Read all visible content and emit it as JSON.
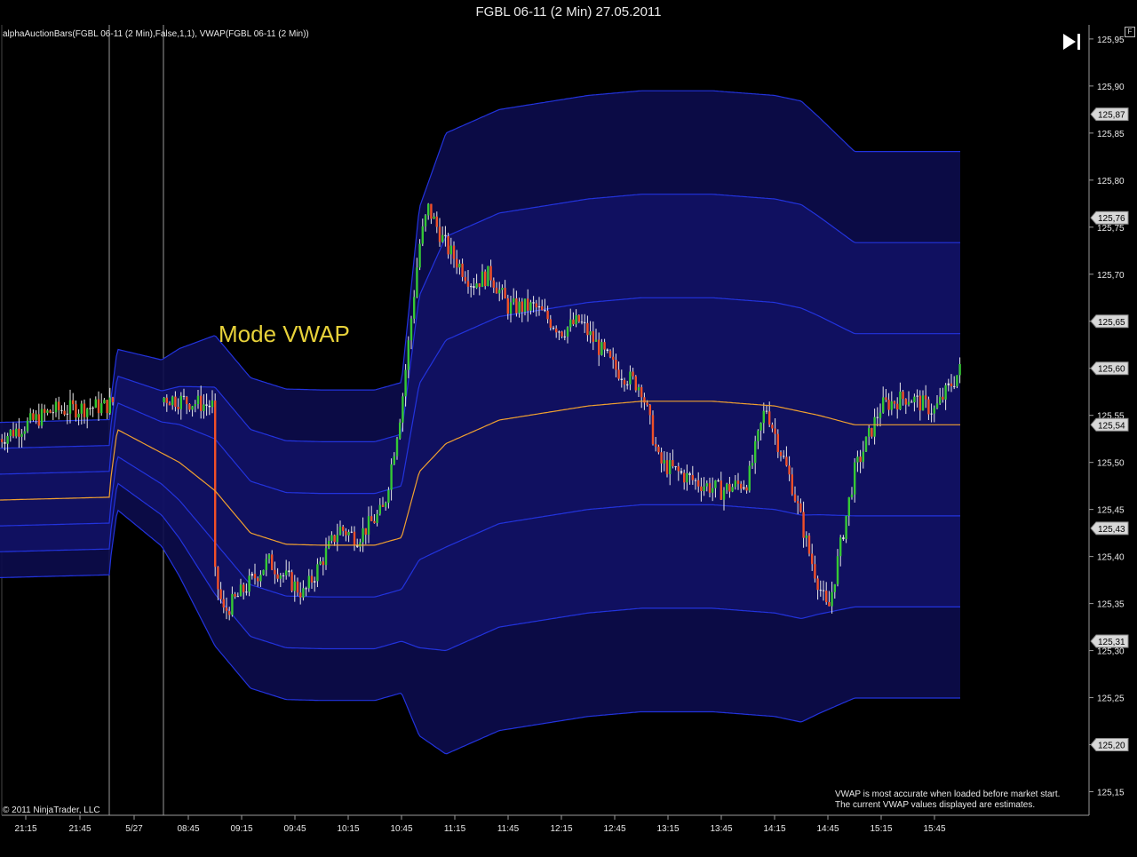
{
  "window": {
    "title": "FGBL 06-11 (2 Min)  27.05.2011",
    "float_button_label": "F"
  },
  "indicator_label": "alphaAuctionBars(FGBL 06-11 (2 Min),False,1,1), VWAP(FGBL 06-11 (2 Min))",
  "annotation": "Mode VWAP",
  "copyright": "© 2011 NinjaTrader, LLC",
  "note": "VWAP is most accurate when loaded before market start.\nThe current VWAP values displayed are estimates.",
  "colors": {
    "background": "#000000",
    "grid": "#9a9a9a",
    "band_line": "#2233dd",
    "band_fill": "#0c0c4c",
    "vwap_line": "#f0a030",
    "candle_up": "#35c835",
    "candle_down": "#f05028",
    "candle_neutral": "#e8e8e8",
    "annotation": "#e8d23a"
  },
  "chart_data": {
    "type": "candlestick",
    "title": "FGBL 06-11 (2 Min)  27.05.2011",
    "x_tick_labels": [
      "21:15",
      "21:45",
      "5/27",
      "08:45",
      "09:15",
      "09:45",
      "10:15",
      "10:45",
      "11:15",
      "11:45",
      "12:15",
      "12:45",
      "13:15",
      "13:45",
      "14:15",
      "14:45",
      "15:15",
      "15:45"
    ],
    "y_tick_labels": [
      "125,95",
      "125,90",
      "125,85",
      "125,80",
      "125,75",
      "125,70",
      "125,65",
      "125,60",
      "125,55",
      "125,50",
      "125,45",
      "125,40",
      "125,35",
      "125,30",
      "125,25",
      "125,20",
      "125,15"
    ],
    "ylim": [
      125.125,
      125.965
    ],
    "session_separators": [
      "5/27 00:00",
      "5/27 08:00"
    ],
    "price_markers": [
      {
        "label": "125,87",
        "value": 125.87
      },
      {
        "label": "125,76",
        "value": 125.76
      },
      {
        "label": "125,65",
        "value": 125.65
      },
      {
        "label": "125,60",
        "value": 125.6
      },
      {
        "label": "125,54",
        "value": 125.54
      },
      {
        "label": "125,43",
        "value": 125.43
      },
      {
        "label": "125,31",
        "value": 125.31
      },
      {
        "label": "125,20",
        "value": 125.2
      }
    ],
    "vwap": [
      [
        "21:00",
        125.46
      ],
      [
        "00:00",
        125.463
      ],
      [
        "08:00",
        125.463
      ],
      [
        "08:05",
        125.535
      ],
      [
        "08:40",
        125.5
      ],
      [
        "09:00",
        125.47
      ],
      [
        "09:20",
        125.425
      ],
      [
        "09:40",
        125.413
      ],
      [
        "10:00",
        125.412
      ],
      [
        "10:30",
        125.412
      ],
      [
        "10:45",
        125.42
      ],
      [
        "10:55",
        125.49
      ],
      [
        "11:10",
        125.52
      ],
      [
        "11:40",
        125.545
      ],
      [
        "12:30",
        125.56
      ],
      [
        "13:00",
        125.565
      ],
      [
        "13:40",
        125.565
      ],
      [
        "14:15",
        125.56
      ],
      [
        "14:40",
        125.55
      ],
      [
        "15:00",
        125.54
      ],
      [
        "15:40",
        125.54
      ],
      [
        "16:00",
        125.54
      ]
    ],
    "bands": {
      "offsets": [
        -0.33,
        -0.22,
        -0.11,
        0.11,
        0.22,
        0.33
      ],
      "session_widths": [
        [
          "21:00",
          0.25
        ],
        [
          "00:00",
          0.25
        ],
        [
          "08:00",
          0.25
        ],
        [
          "08:30",
          0.3
        ],
        [
          "09:00",
          0.5
        ],
        [
          "10:45",
          0.5
        ],
        [
          "10:55",
          0.85
        ],
        [
          "11:10",
          1.0
        ],
        [
          "14:30",
          1.0
        ],
        [
          "15:00",
          0.88
        ],
        [
          "16:00",
          0.88
        ]
      ]
    },
    "ohlc_path": [
      [
        "21:00",
        125.525
      ],
      [
        "21:30",
        125.555
      ],
      [
        "22:00",
        125.56
      ],
      [
        "22:15",
        125.575
      ],
      [
        "23:00",
        125.56
      ],
      [
        "00:00",
        125.6
      ],
      [
        "00:30",
        125.47
      ],
      [
        "01:30",
        125.48
      ],
      [
        "07:59",
        125.5
      ],
      [
        "08:00",
        125.555
      ],
      [
        "08:15",
        125.52
      ],
      [
        "08:35",
        125.48
      ],
      [
        "08:55",
        125.42
      ],
      [
        "09:05",
        125.34
      ],
      [
        "09:30",
        125.395
      ],
      [
        "09:50",
        125.36
      ],
      [
        "10:10",
        125.43
      ],
      [
        "10:20",
        125.42
      ],
      [
        "10:35",
        125.45
      ],
      [
        "10:45",
        125.56
      ],
      [
        "10:55",
        125.73
      ],
      [
        "11:00",
        125.77
      ],
      [
        "11:10",
        125.73
      ],
      [
        "11:25",
        125.69
      ],
      [
        "11:35",
        125.7
      ],
      [
        "11:45",
        125.665
      ],
      [
        "12:00",
        125.665
      ],
      [
        "12:15",
        125.64
      ],
      [
        "12:25",
        125.65
      ],
      [
        "12:45",
        125.6
      ],
      [
        "13:00",
        125.58
      ],
      [
        "13:10",
        125.5
      ],
      [
        "13:30",
        125.48
      ],
      [
        "13:45",
        125.47
      ],
      [
        "14:00",
        125.48
      ],
      [
        "14:10",
        125.56
      ],
      [
        "14:25",
        125.475
      ],
      [
        "14:35",
        125.4
      ],
      [
        "14:45",
        125.34
      ],
      [
        "15:00",
        125.49
      ],
      [
        "15:15",
        125.56
      ],
      [
        "15:30",
        125.57
      ],
      [
        "15:45",
        125.555
      ],
      [
        "16:00",
        125.6
      ]
    ]
  }
}
